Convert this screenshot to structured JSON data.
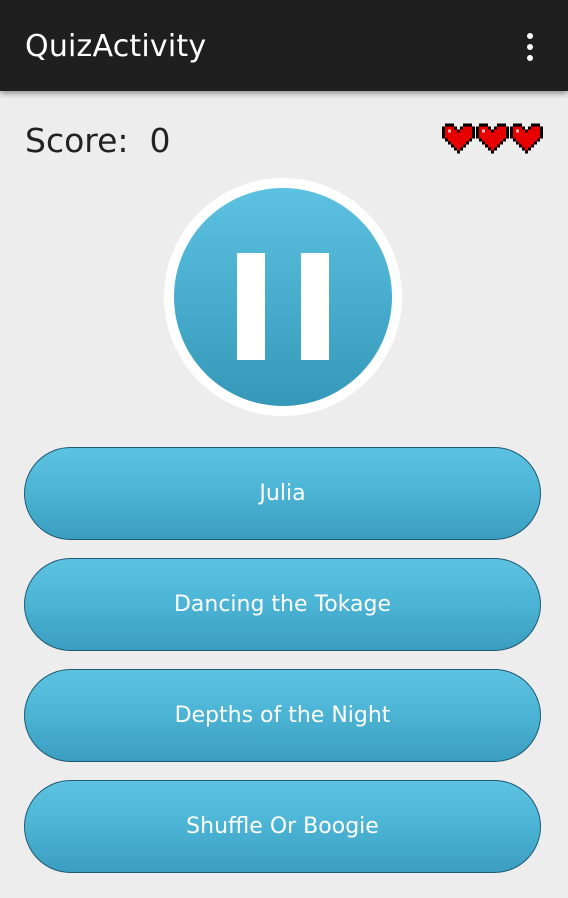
{
  "app_bar": {
    "title": "QuizActivity",
    "overflow_icon": "more-vert-icon"
  },
  "game": {
    "score_label": "Score:  0",
    "lives": 3,
    "heart_color": "#e80000",
    "pause_icon": "pause-icon"
  },
  "answers": [
    {
      "label": "Julia"
    },
    {
      "label": "Dancing the Tokage"
    },
    {
      "label": "Depths of the Night"
    },
    {
      "label": "Shuffle Or Boogie"
    }
  ],
  "colors": {
    "action_bar": "#1f1f1f",
    "background": "#ededed",
    "button_accent": "#4db5d6",
    "button_border": "#1f5a72"
  }
}
